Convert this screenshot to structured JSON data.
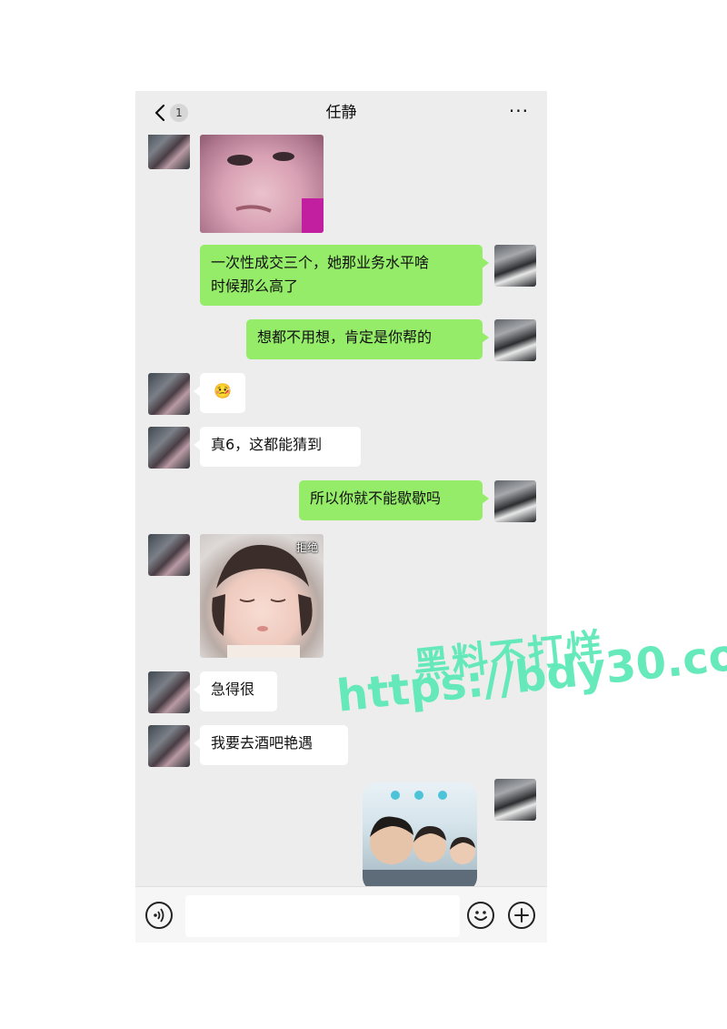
{
  "header": {
    "back_badge": "1",
    "title": "任静",
    "more": "···"
  },
  "messages": [
    {
      "side": "left",
      "type": "sticker",
      "description": "crop of pouting child face"
    },
    {
      "side": "right",
      "type": "text",
      "text": "一次性成交三个，她那业务水平啥\n时候那么高了"
    },
    {
      "side": "right",
      "type": "text",
      "text": "想都不用想，肯定是你帮的"
    },
    {
      "side": "left",
      "type": "emoji",
      "text": "🤒"
    },
    {
      "side": "left",
      "type": "text",
      "text": "真6，这都能猜到"
    },
    {
      "side": "right",
      "type": "text",
      "text": "所以你就不能歇歇吗"
    },
    {
      "side": "left",
      "type": "sticker",
      "label": "拒绝"
    },
    {
      "side": "left",
      "type": "text",
      "text": "急得很"
    },
    {
      "side": "left",
      "type": "text",
      "text": "我要去酒吧艳遇"
    },
    {
      "side": "right",
      "type": "sticker",
      "description": "three kids photo sticker"
    }
  ],
  "msg": {
    "m2_line1": "一次性成交三个，她那业务水平啥",
    "m2_line2": "时候那么高了",
    "m3": "想都不用想，肯定是你帮的",
    "m4_emoji": "🤒",
    "m5": "真6，这都能猜到",
    "m6": "所以你就不能歇歇吗",
    "m7_label": "拒绝",
    "m8": "急得很",
    "m9": "我要去酒吧艳遇"
  },
  "input": {
    "value": "",
    "placeholder": ""
  },
  "watermark": {
    "line1": "黑料不打烊",
    "line2": "https://bdy30.co"
  },
  "colors": {
    "chat_bg": "#ededed",
    "self_bubble": "#95ec69",
    "other_bubble": "#ffffff",
    "watermark": "#5fe9b8"
  }
}
